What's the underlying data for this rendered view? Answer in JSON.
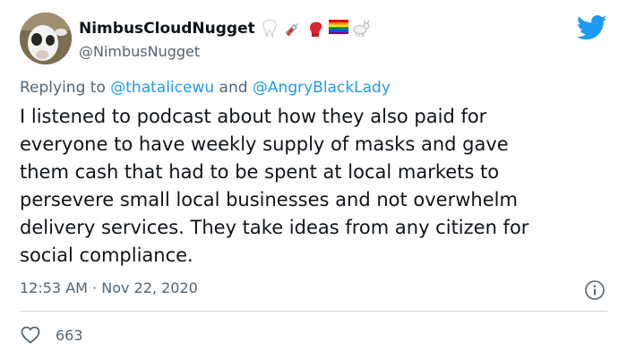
{
  "author": {
    "display_name": "NimbusCloudNugget",
    "handle": "@NimbusNugget",
    "name_emojis": [
      "tooth-emoji",
      "syringe-emoji",
      "boxing-glove-emoji",
      "rainbow-flag-emoji",
      "goat-emoji"
    ]
  },
  "reply": {
    "prefix": "Replying to",
    "mention_1": "@thatalicewu",
    "conjunction": "and",
    "mention_2": "@AngryBlackLady"
  },
  "tweet": {
    "lines": [
      "I listened to podcast about how they also paid for",
      "everyone to have weekly supply of masks and gave",
      "them cash that had to be spent at local markets to",
      "persevere small local businesses and not overwhelm",
      "delivery services. They take ideas from any citizen for",
      "social compliance."
    ],
    "time": "12:53 AM",
    "separator": "·",
    "date": "Nov 22, 2020"
  },
  "engagement": {
    "likes": "663"
  },
  "colors": {
    "link": "#1d9bf0",
    "secondary_text": "#536471",
    "divider": "#cfd9de"
  }
}
